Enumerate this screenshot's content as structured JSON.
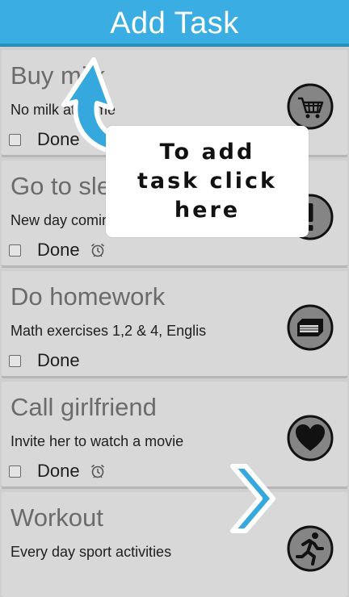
{
  "header": {
    "title": "Add Task"
  },
  "tasks": [
    {
      "title": "Buy milk",
      "description": "No milk at home",
      "done_label": "Done",
      "has_alarm": false,
      "category_icon": "cart-icon"
    },
    {
      "title": "Go to sleep",
      "description": "New day coming",
      "done_label": "Done",
      "has_alarm": true,
      "category_icon": "exclamation-icon"
    },
    {
      "title": "Do homework",
      "description": "Math exercises 1,2 & 4, Englis",
      "done_label": "Done",
      "has_alarm": false,
      "category_icon": "book-icon"
    },
    {
      "title": "Call girlfriend",
      "description": "Invite her to watch a movie",
      "done_label": "Done",
      "has_alarm": true,
      "category_icon": "heart-icon"
    },
    {
      "title": "Workout",
      "description": "Every day sport activities",
      "done_label": "Done",
      "has_alarm": false,
      "category_icon": "runner-icon"
    }
  ],
  "tutorial": {
    "text": "To add\ntask click\nhere"
  },
  "colors": {
    "header": "#3aaee2",
    "arrow": "#35a8dd",
    "card": "#d8d8d8"
  }
}
